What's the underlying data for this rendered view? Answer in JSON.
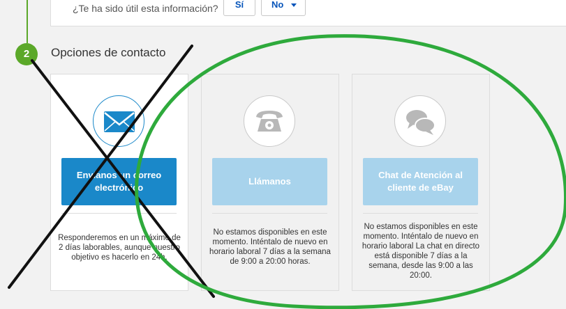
{
  "feedback": {
    "question": "¿Te ha sido útil esta información?",
    "yes_label": "Sí",
    "no_label": "No"
  },
  "section": {
    "step_number": "2",
    "title": "Opciones de contacto"
  },
  "cards": [
    {
      "button_label": "Envíanos un correo electrónico",
      "description": "Responderemos en un máximo de 2 días laborables, aunque nuestro objetivo es hacerlo en 24h.",
      "icon": "envelope-icon"
    },
    {
      "button_label": "Llámanos",
      "description": "No estamos disponibles en este momento. Inténtalo de nuevo en horario laboral 7 días a la semana de 9:00 a 20:00 horas.",
      "icon": "phone-icon"
    },
    {
      "button_label": "Chat de Atención al cliente de eBay",
      "description": "No estamos disponibles en este momento. Inténtalo de nuevo en horario laboral La chat en directo está disponible 7 días a la semana, desde las 9:00 a las 20:00.",
      "icon": "chat-icon"
    }
  ],
  "colors": {
    "accent_green": "#5ba829",
    "primary_blue": "#1a88c9",
    "disabled_blue": "#a8d3ec",
    "annotation_green": "#2eaa3c"
  }
}
